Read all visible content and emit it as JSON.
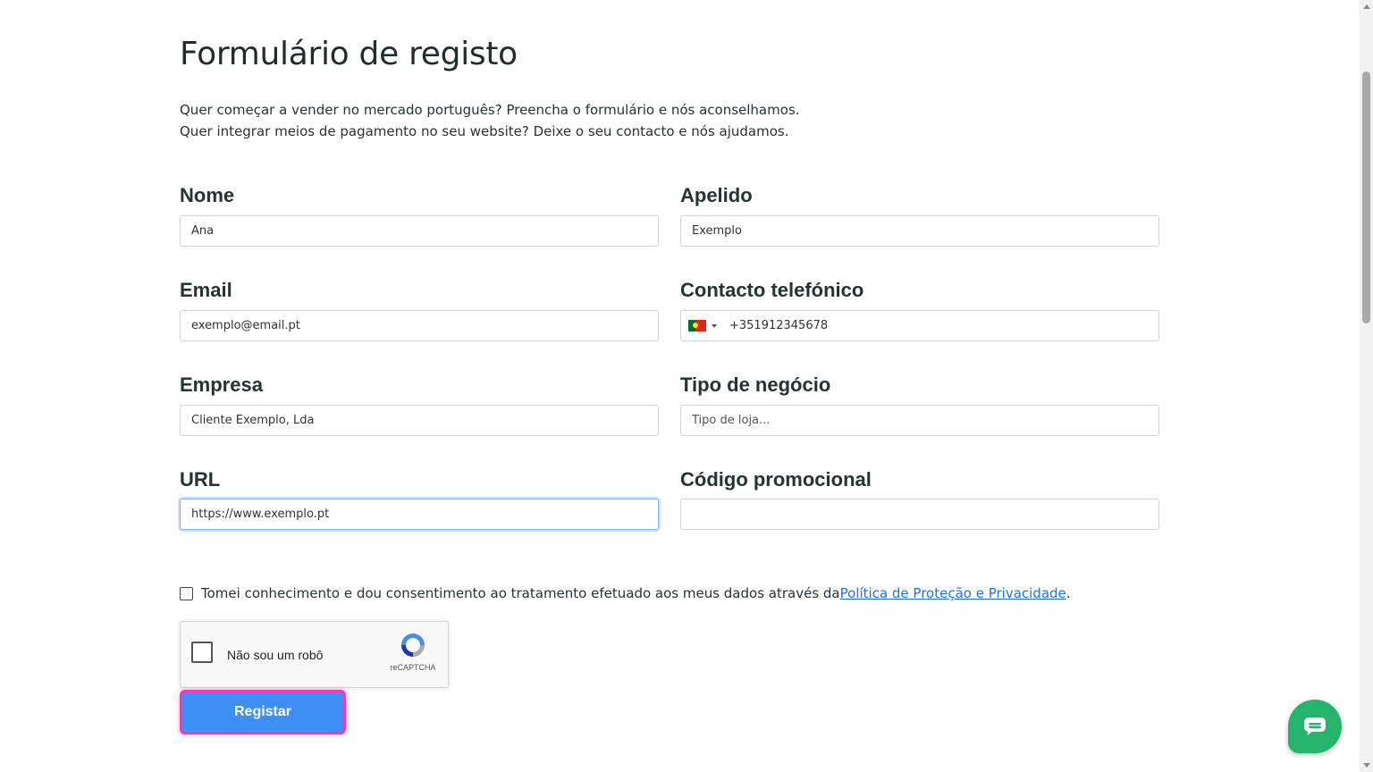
{
  "page": {
    "title": "Formulário de registo",
    "intro_line1": "Quer começar a vender no mercado português? Preencha o formulário e nós aconselhamos.",
    "intro_line2": "Quer integrar meios de pagamento no seu website? Deixe o seu contacto e nós ajudamos."
  },
  "form": {
    "nome": {
      "label": "Nome",
      "value": "Ana"
    },
    "apelido": {
      "label": "Apelido",
      "value": "Exemplo"
    },
    "email": {
      "label": "Email",
      "value": "exemplo@email.pt"
    },
    "telefone": {
      "label": "Contacto telefónico",
      "value": "+351912345678",
      "country": "PT"
    },
    "empresa": {
      "label": "Empresa",
      "value": "Cliente Exemplo, Lda"
    },
    "tipo_negocio": {
      "label": "Tipo de negócio",
      "value": "",
      "placeholder": "Tipo de loja..."
    },
    "url": {
      "label": "URL",
      "value": "https://www.exemplo.pt"
    },
    "codigo_promocional": {
      "label": "Código promocional",
      "value": ""
    }
  },
  "consent": {
    "text": "Tomei conhecimento e dou consentimento ao tratamento efetuado aos meus dados através da ",
    "link": "Política de Proteção e Privacidade",
    "suffix": ".",
    "checked": false
  },
  "recaptcha": {
    "label": "Não sou um robô",
    "brand": "reCAPTCHA",
    "checked": false
  },
  "submit": {
    "label": "Registar"
  },
  "colors": {
    "primary_button": "#3d8ff5",
    "focus_outline": "#f03ab4",
    "chat_button": "#26b36b",
    "link": "#1a73e8"
  }
}
